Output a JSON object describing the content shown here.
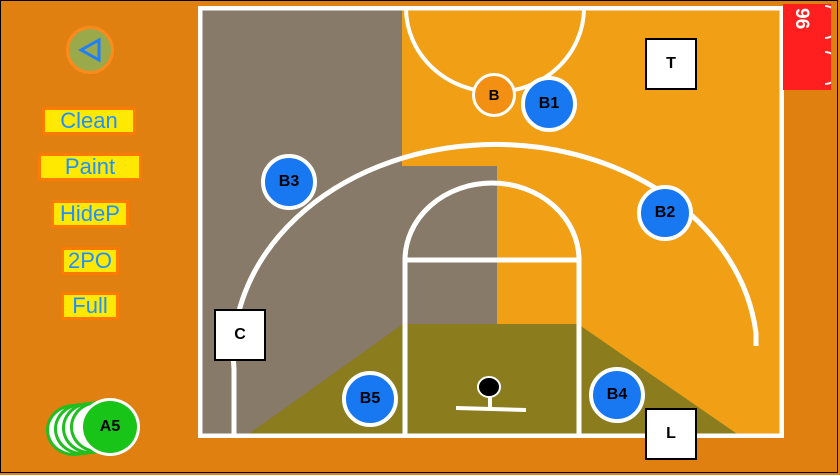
{
  "menu": {
    "back_icon": "triangle-left-icon",
    "buttons": [
      "Clean",
      "Paint",
      "HideP",
      "2PO",
      "Full"
    ]
  },
  "court": {
    "ball_label": "B",
    "players": [
      "B1",
      "B2",
      "B3",
      "B4",
      "B5"
    ],
    "markers": [
      "T",
      "C",
      "L"
    ]
  },
  "score": {
    "value": "96"
  },
  "bench": {
    "top_label": "A5"
  },
  "colors": {
    "background": "#e08010",
    "court_left": "#887a68",
    "court_right": "#f19f14",
    "paint_zone": "#8b7c1d",
    "player_blue": "#1778f2",
    "bench_green": "#18c418",
    "score_red": "#ff1f1f"
  }
}
